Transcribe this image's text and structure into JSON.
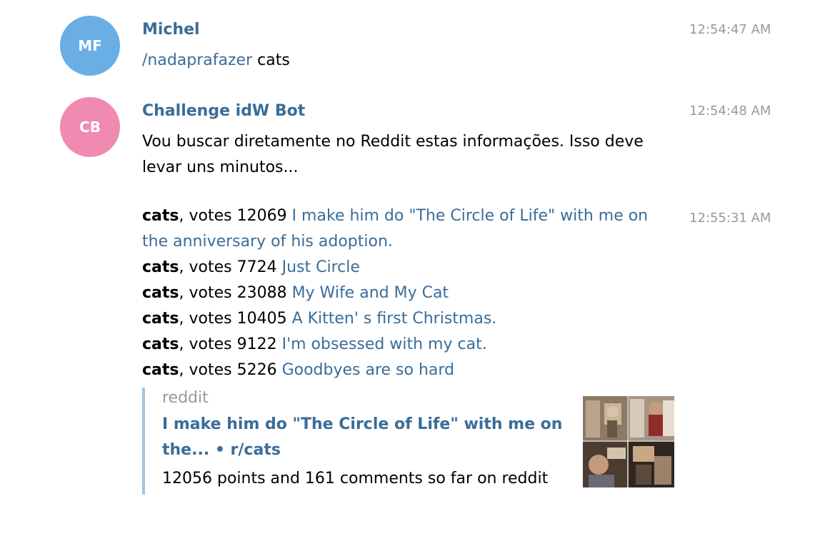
{
  "messages": [
    {
      "avatar_initials": "MF",
      "avatar_color": "#6aaee6",
      "sender": "Michel",
      "time": "12:54:47 AM",
      "command": "/nadaprafazer",
      "argument": " cats"
    },
    {
      "avatar_initials": "CB",
      "avatar_color": "#f08ab1",
      "sender": "Challenge idW Bot",
      "time": "12:54:48 AM",
      "text": "Vou buscar diretamente no Reddit estas informações. Isso deve levar uns minutos..."
    }
  ],
  "results": {
    "time": "12:55:31 AM",
    "posts": [
      {
        "subreddit": "cats",
        "votes_text": ", votes 12069 ",
        "title": "I make him do \"The Circle of Life\" with me on the anniversary of his adoption."
      },
      {
        "subreddit": "cats",
        "votes_text": ", votes 7724 ",
        "title": "Just Circle"
      },
      {
        "subreddit": "cats",
        "votes_text": ", votes 23088 ",
        "title": "My Wife and My Cat"
      },
      {
        "subreddit": "cats",
        "votes_text": ", votes 10405 ",
        "title": "A Kitten' s first Christmas."
      },
      {
        "subreddit": "cats",
        "votes_text": ", votes 9122 ",
        "title": "I'm obsessed with my cat."
      },
      {
        "subreddit": "cats",
        "votes_text": ", votes 5226 ",
        "title": "Goodbyes are so hard"
      }
    ],
    "preview": {
      "site": "reddit",
      "title": "I make him do \"The Circle of Life\" with me on the... • r/cats",
      "description": "12056 points and 161 comments so far on reddit"
    }
  },
  "colors": {
    "link": "#3a6d99",
    "time": "#999999",
    "preview_bar": "#a7c4de"
  }
}
